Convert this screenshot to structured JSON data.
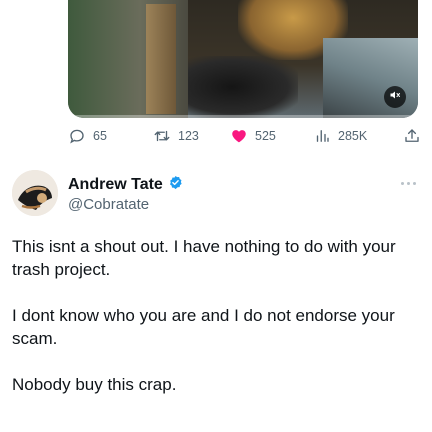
{
  "media": {
    "progress": 0.0,
    "mute_icon": "speaker-muted-icon"
  },
  "actions": {
    "reply_count": "65",
    "retweet_count": "123",
    "like_count": "525",
    "view_count": "285K"
  },
  "tweet": {
    "author_name": "Andrew Tate",
    "handle": "@Cobratate",
    "verified": true,
    "paragraphs": [
      "This isnt a shout out. I have nothing to do with your trash project.",
      "I dont know who you are and I do not endorse your scam.",
      "Nobody buy this crap."
    ]
  },
  "colors": {
    "like": "#f91880",
    "verified": "#1d9bf0",
    "muted_text": "#536471"
  }
}
